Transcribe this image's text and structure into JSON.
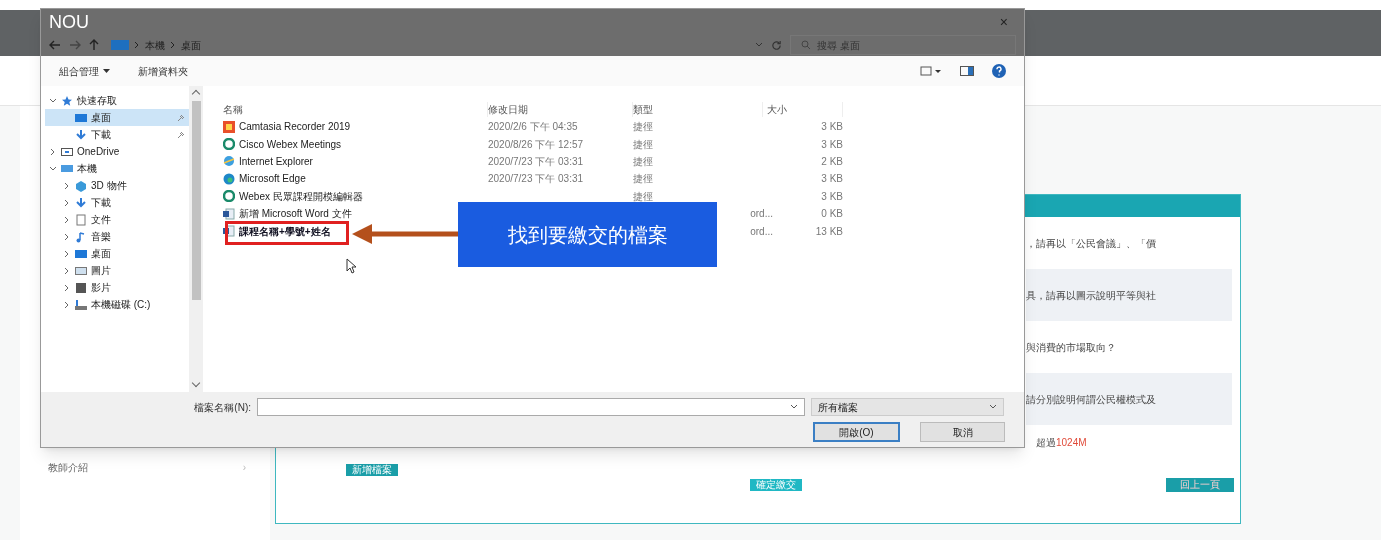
{
  "page": {
    "sidebar_items": [
      {
        "label": "教師介紹",
        "chevron": "›"
      }
    ],
    "card_rows": [
      "，請再以「公民會議」、「價",
      "具，請再以圖示說明平等與社",
      "與消費的市場取向？",
      "請分別說明何謂公民權模式及"
    ],
    "size_note": {
      "text": "超過",
      "highlight": "1024M"
    },
    "add_file_button": "新增檔案",
    "submit_button": "確定繳交",
    "back_button": "回上一頁"
  },
  "dialog": {
    "logo": "NOU",
    "close": "×",
    "breadcrumbs": [
      "本機",
      "桌面"
    ],
    "search": {
      "placeholder": "搜尋 桌面"
    },
    "toolbar": [
      {
        "label": "組合管理",
        "dropdown": true
      },
      {
        "label": "新增資料夾",
        "dropdown": false
      }
    ],
    "nav": [
      {
        "label": "快速存取",
        "kind": "star",
        "expanded": true,
        "children": [
          {
            "label": "桌面",
            "kind": "desktop",
            "selected": true,
            "pinned": true
          },
          {
            "label": "下載",
            "kind": "download",
            "selected": false,
            "pinned": true
          }
        ]
      },
      {
        "label": "OneDrive",
        "kind": "cloud",
        "expanded": false
      },
      {
        "label": "本機",
        "kind": "pc",
        "expanded": true,
        "children": [
          {
            "label": "3D 物件",
            "kind": "cube",
            "selected": false,
            "pinned": false
          },
          {
            "label": "下載",
            "kind": "download",
            "selected": false,
            "pinned": false
          },
          {
            "label": "文件",
            "kind": "doc",
            "selected": false,
            "pinned": false
          },
          {
            "label": "音樂",
            "kind": "music",
            "selected": false,
            "pinned": false
          },
          {
            "label": "桌面",
            "kind": "desktop",
            "selected": false,
            "pinned": false
          },
          {
            "label": "圖片",
            "kind": "image",
            "selected": false,
            "pinned": false
          },
          {
            "label": "影片",
            "kind": "film",
            "selected": false,
            "pinned": false
          },
          {
            "label": "本機磁碟 (C:)",
            "kind": "drive",
            "selected": false,
            "pinned": false
          }
        ]
      }
    ],
    "columns": [
      "名稱",
      "修改日期",
      "類型",
      "大小"
    ],
    "files": [
      {
        "name": "Camtasia Recorder 2019",
        "kind": "camtasia",
        "date": "2020/2/6 下午 04:35",
        "type": "捷徑",
        "size": "3 KB",
        "highlighted": false
      },
      {
        "name": "Cisco Webex Meetings",
        "kind": "webex",
        "date": "2020/8/26 下午 12:57",
        "type": "捷徑",
        "size": "3 KB",
        "highlighted": false
      },
      {
        "name": "Internet Explorer",
        "kind": "ie",
        "date": "2020/7/23 下午 03:31",
        "type": "捷徑",
        "size": "2 KB",
        "highlighted": false
      },
      {
        "name": "Microsoft Edge",
        "kind": "edge",
        "date": "2020/7/23 下午 03:31",
        "type": "捷徑",
        "size": "3 KB",
        "highlighted": false
      },
      {
        "name": "Webex 民眾課程開模編輯器",
        "kind": "webex",
        "type": "捷徑",
        "size": "3 KB",
        "highlighted": false
      },
      {
        "name": "新增 Microsoft Word 文件",
        "kind": "word",
        "type": "ord...",
        "size": "0 KB",
        "highlighted": false
      },
      {
        "name": "課程名稱+學號+姓名",
        "kind": "word",
        "type": "ord...",
        "size": "13 KB",
        "highlighted": true
      }
    ],
    "filename_label": "檔案名稱(N):",
    "filter": "所有檔案",
    "open_button": "開啟(O)",
    "cancel_button": "取消"
  },
  "callout": {
    "text": "找到要繳交的檔案"
  }
}
